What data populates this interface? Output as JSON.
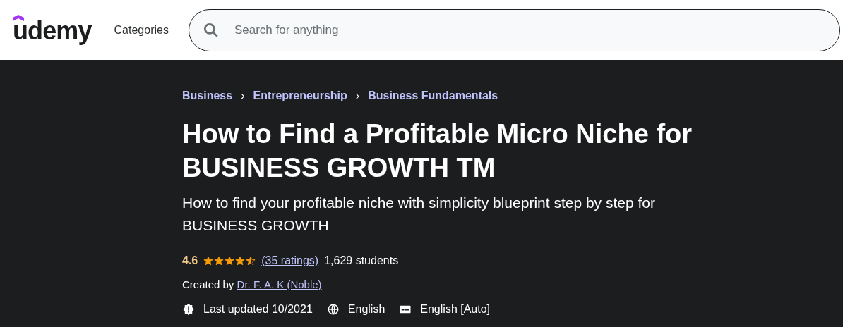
{
  "header": {
    "logo": "udemy",
    "categories": "Categories",
    "search": {
      "placeholder": "Search for anything"
    }
  },
  "breadcrumbs": [
    {
      "label": "Business"
    },
    {
      "label": "Entrepreneurship"
    },
    {
      "label": "Business Fundamentals"
    }
  ],
  "breadcrumb_separator": "›",
  "title": "How to Find a Profitable Micro Niche for BUSINESS GROWTH TM",
  "subtitle": "How to find your profitable niche with simplicity blueprint step by step for BUSINESS GROWTH",
  "rating": {
    "score": "4.6",
    "stars": 4.5,
    "ratings_link": "(35 ratings)",
    "students": "1,629 students"
  },
  "created_by": {
    "label": "Created by",
    "author": "Dr. F. A. K (Noble)"
  },
  "meta": [
    {
      "kind": "updated",
      "text": "Last updated 10/2021"
    },
    {
      "kind": "language",
      "text": "English"
    },
    {
      "kind": "captions",
      "text": "English [Auto]"
    }
  ]
}
